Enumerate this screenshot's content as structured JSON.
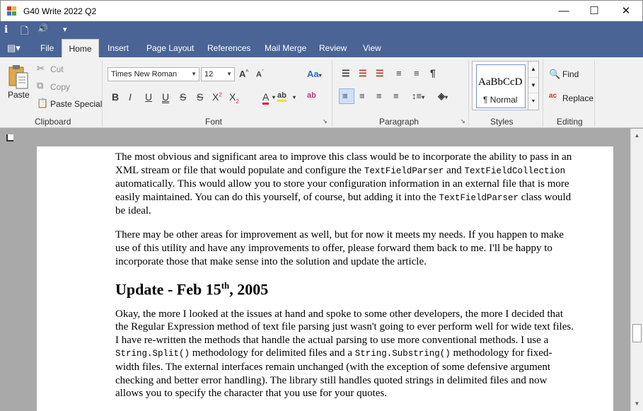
{
  "window": {
    "title": "G40 Write 2022 Q2",
    "minimize": "—",
    "maximize": "☐",
    "close": "✕"
  },
  "qat": {
    "info_icon": "ℹ",
    "newdoc_icon": "🗋",
    "sound_icon": "🔊",
    "dropdown_icon": "▾"
  },
  "menu": {
    "file": "File",
    "home": "Home",
    "insert": "Insert",
    "page_layout": "Page Layout",
    "references": "References",
    "mail_merge": "Mail Merge",
    "review": "Review",
    "view": "View"
  },
  "ribbon": {
    "clipboard": {
      "label": "Clipboard",
      "paste": "Paste",
      "cut": "Cut",
      "copy": "Copy",
      "paste_special": "Paste Special"
    },
    "font": {
      "label": "Font",
      "family": "Times New Roman",
      "size": "12"
    },
    "paragraph": {
      "label": "Paragraph"
    },
    "styles": {
      "label": "Styles",
      "sample": "AaBbCcD",
      "normal": "¶ Normal"
    },
    "editing": {
      "label": "Editing",
      "find": "Find",
      "replace": "Replace"
    }
  },
  "document": {
    "p1_a": "The most obvious and significant area to improve this class would be to incorporate the ability to pass in an XML stream or file that would populate and configure the ",
    "p1_code1": "TextFieldParser",
    "p1_b": " and ",
    "p1_code2": "TextFieldCollection",
    "p1_c": " automatically. This would allow you to store your configuration information in an external file that is more easily maintained. You can do this yourself, of course, but adding it into the ",
    "p1_code3": "TextFieldParser",
    "p1_d": " class would be ideal.",
    "p2": "There may be other areas for improvement as well, but for now it meets my needs. If you happen to make use of this utility and have any improvements to offer, please forward them back to me. I'll be happy to incorporate those that make sense into the solution and update the article.",
    "heading_a": "Update - Feb 15",
    "heading_sup": "th",
    "heading_b": ", 2005",
    "p3_a": "Okay, the more I looked at the issues at hand and spoke to some other developers, the more I decided that the Regular Expression method of text file parsing just wasn't going to ever perform well for wide text files. I have re-written the methods that handle the actual parsing to use more conventional methods. I use a ",
    "p3_code1": "String.Split()",
    "p3_b": " methodology for delimited files and a ",
    "p3_code2": "String.Substring()",
    "p3_c": " methodology for fixed-width files. The external interfaces remain unchanged (with the exception of some defensive argument checking and better error handling). The library still handles quoted strings in delimited files and now allows you to specify the character that you use for your quotes."
  }
}
